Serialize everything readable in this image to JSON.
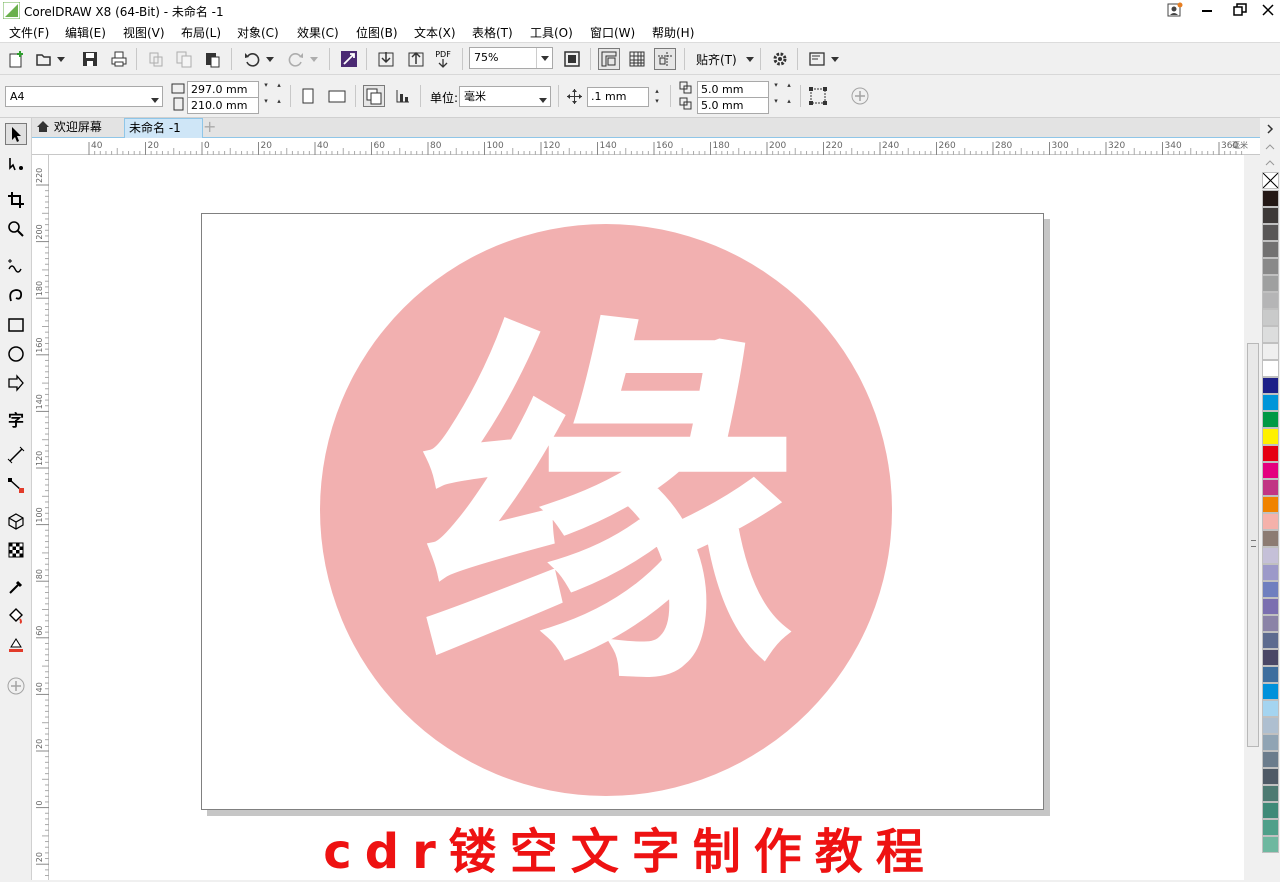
{
  "window": {
    "title": "CorelDRAW X8 (64-Bit) - 未命名 -1"
  },
  "menu": [
    "文件(F)",
    "编辑(E)",
    "视图(V)",
    "布局(L)",
    "对象(C)",
    "效果(C)",
    "位图(B)",
    "文本(X)",
    "表格(T)",
    "工具(O)",
    "窗口(W)",
    "帮助(H)"
  ],
  "standard_toolbar": {
    "pdf_label": "PDF",
    "zoom": "75%",
    "snap_label": "贴齐(T)"
  },
  "property_bar": {
    "page_size": "A4",
    "width": "297.0 mm",
    "height": "210.0 mm",
    "unit_label": "单位:",
    "unit": "毫米",
    "nudge": ".1 mm",
    "dup_x": "5.0 mm",
    "dup_y": "5.0 mm"
  },
  "tabs": [
    {
      "label": "欢迎屏幕",
      "icon": "home-icon"
    },
    {
      "label": "未命名 -1"
    }
  ],
  "ruler": {
    "h_labels": [
      "40",
      "20",
      "0",
      "20",
      "40",
      "60",
      "80",
      "100",
      "120",
      "140",
      "160",
      "180",
      "200",
      "220",
      "240",
      "260",
      "280",
      "300",
      "320",
      "340",
      "360"
    ],
    "v_labels": [
      "220",
      "200",
      "180",
      "160",
      "140",
      "120",
      "100",
      "80",
      "60",
      "40",
      "20",
      "0",
      "20"
    ],
    "h_unit": "毫米"
  },
  "document": {
    "circle_color": "#f2b0b0",
    "glyph": "缘"
  },
  "caption": "cdr镂空文字制作教程",
  "palette": [
    "#231815",
    "#3e3a39",
    "#595757",
    "#727171",
    "#898989",
    "#9fa0a0",
    "#b5b5b6",
    "#c9caca",
    "#dcdddd",
    "#efefef",
    "#ffffff",
    "#1d2088",
    "#0095d9",
    "#009944",
    "#fff100",
    "#e60012",
    "#e4007f",
    "#c13584",
    "#f08300",
    "#f5b1aa",
    "#8c7b72",
    "#c5c0d8",
    "#9c99c9",
    "#6f7fbf",
    "#7b6fb0",
    "#8b83a7",
    "#5d6b8f",
    "#4a4766",
    "#3e6e9e",
    "#0091db",
    "#a4d4f0",
    "#aebfd0",
    "#90a4b4",
    "#6b7c8c",
    "#4f5a66",
    "#4d7a72",
    "#3f8a78",
    "#4fa08a",
    "#6eb8a0"
  ]
}
